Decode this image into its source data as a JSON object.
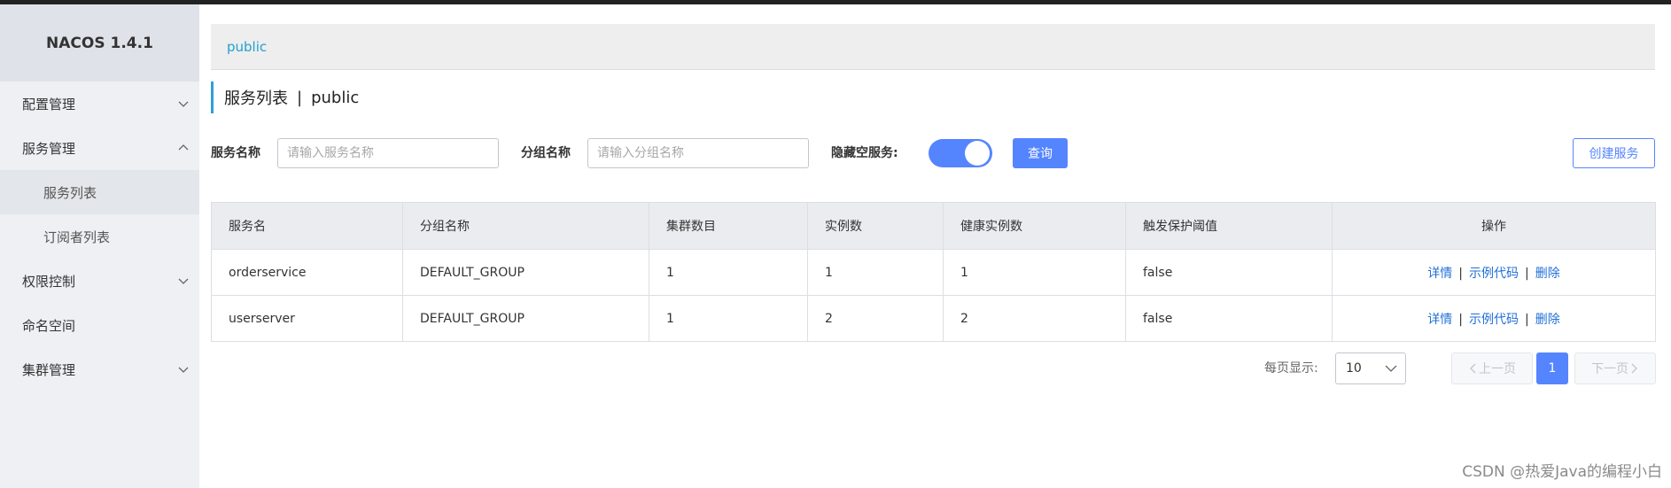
{
  "app": {
    "title": "NACOS 1.4.1"
  },
  "sidebar": {
    "items": [
      {
        "label": "配置管理"
      },
      {
        "label": "服务管理"
      },
      {
        "label": "服务列表"
      },
      {
        "label": "订阅者列表"
      },
      {
        "label": "权限控制"
      },
      {
        "label": "命名空间"
      },
      {
        "label": "集群管理"
      }
    ]
  },
  "breadcrumb": {
    "namespace": "public"
  },
  "page": {
    "title": "服务列表",
    "separator": "|",
    "namespace": "public"
  },
  "filters": {
    "service_label": "服务名称",
    "service_placeholder": "请输入服务名称",
    "group_label": "分组名称",
    "group_placeholder": "请输入分组名称",
    "hide_empty_label": "隐藏空服务:",
    "hide_empty_on": true,
    "query_button": "查询",
    "create_button": "创建服务"
  },
  "table": {
    "headers": [
      "服务名",
      "分组名称",
      "集群数目",
      "实例数",
      "健康实例数",
      "触发保护阈值",
      "操作"
    ],
    "rows": [
      {
        "name": "orderservice",
        "group": "DEFAULT_GROUP",
        "clusters": "1",
        "instances": "1",
        "healthy": "1",
        "threshold": "false"
      },
      {
        "name": "userserver",
        "group": "DEFAULT_GROUP",
        "clusters": "1",
        "instances": "2",
        "healthy": "2",
        "threshold": "false"
      }
    ],
    "actions": {
      "detail": "详情",
      "sample": "示例代码",
      "delete": "删除",
      "sep": "|"
    }
  },
  "pagination": {
    "page_size_label": "每页显示:",
    "page_size": "10",
    "prev": "上一页",
    "current": "1",
    "next": "下一页"
  },
  "watermark": "CSDN @热爱Java的编程小白",
  "colors": {
    "primary": "#5584ff",
    "link": "#1f6fd6",
    "crumb": "#22a0d0",
    "sidebar": "#eef0f3"
  }
}
